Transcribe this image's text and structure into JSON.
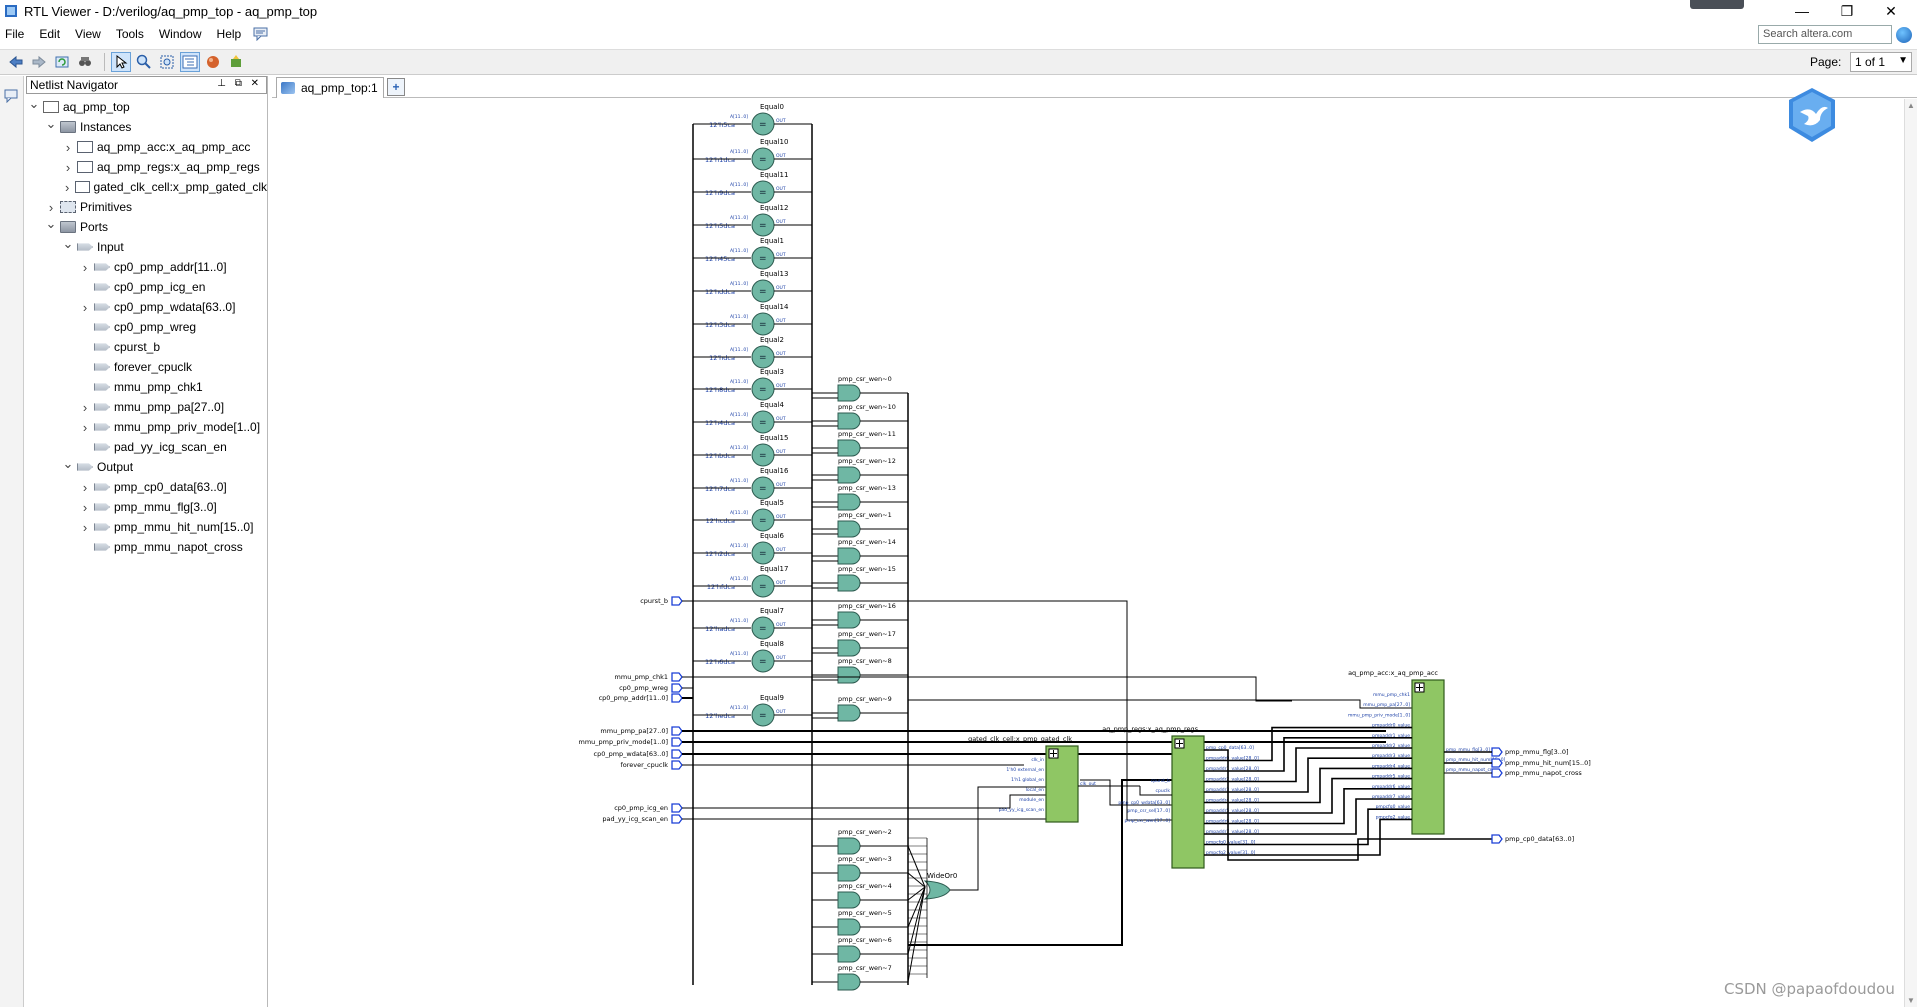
{
  "window": {
    "title": "RTL Viewer - D:/verilog/aq_pmp_top - aq_pmp_top",
    "minimize": "—",
    "maximize": "❐",
    "close": "✕"
  },
  "menu": [
    "File",
    "Edit",
    "View",
    "Tools",
    "Window",
    "Help"
  ],
  "search": {
    "placeholder": "Search altera.com"
  },
  "toolbar": {
    "page_label": "Page:",
    "page_value": "1 of 1"
  },
  "navigator": {
    "title": "Netlist Navigator",
    "tree": [
      {
        "label": "aq_pmp_top",
        "level": 0,
        "chev": "v",
        "icon": "top"
      },
      {
        "label": "Instances",
        "level": 1,
        "chev": "v",
        "icon": "folder"
      },
      {
        "label": "aq_pmp_acc:x_aq_pmp_acc",
        "level": 2,
        "chev": ">",
        "icon": "inst"
      },
      {
        "label": "aq_pmp_regs:x_aq_pmp_regs",
        "level": 2,
        "chev": ">",
        "icon": "inst"
      },
      {
        "label": "gated_clk_cell:x_pmp_gated_clk",
        "level": 2,
        "chev": ">",
        "icon": "inst"
      },
      {
        "label": "Primitives",
        "level": 1,
        "chev": ">",
        "icon": "prim"
      },
      {
        "label": "Ports",
        "level": 1,
        "chev": "v",
        "icon": "folder"
      },
      {
        "label": "Input",
        "level": 2,
        "chev": "v",
        "icon": "port"
      },
      {
        "label": "cp0_pmp_addr[11..0]",
        "level": 3,
        "chev": ">",
        "icon": "port"
      },
      {
        "label": "cp0_pmp_icg_en",
        "level": 3,
        "chev": "",
        "icon": "port"
      },
      {
        "label": "cp0_pmp_wdata[63..0]",
        "level": 3,
        "chev": ">",
        "icon": "port"
      },
      {
        "label": "cp0_pmp_wreg",
        "level": 3,
        "chev": "",
        "icon": "port"
      },
      {
        "label": "cpurst_b",
        "level": 3,
        "chev": "",
        "icon": "port"
      },
      {
        "label": "forever_cpuclk",
        "level": 3,
        "chev": "",
        "icon": "port"
      },
      {
        "label": "mmu_pmp_chk1",
        "level": 3,
        "chev": "",
        "icon": "port"
      },
      {
        "label": "mmu_pmp_pa[27..0]",
        "level": 3,
        "chev": ">",
        "icon": "port"
      },
      {
        "label": "mmu_pmp_priv_mode[1..0]",
        "level": 3,
        "chev": ">",
        "icon": "port"
      },
      {
        "label": "pad_yy_icg_scan_en",
        "level": 3,
        "chev": "",
        "icon": "port"
      },
      {
        "label": "Output",
        "level": 2,
        "chev": "v",
        "icon": "port"
      },
      {
        "label": "pmp_cp0_data[63..0]",
        "level": 3,
        "chev": ">",
        "icon": "port"
      },
      {
        "label": "pmp_mmu_flg[3..0]",
        "level": 3,
        "chev": ">",
        "icon": "port"
      },
      {
        "label": "pmp_mmu_hit_num[15..0]",
        "level": 3,
        "chev": ">",
        "icon": "port"
      },
      {
        "label": "pmp_mmu_napot_cross",
        "level": 3,
        "chev": "",
        "icon": "port"
      }
    ]
  },
  "editor": {
    "tab_label": "aq_pmp_top:1"
  },
  "schematic": {
    "comparators": [
      {
        "name": "Equal0",
        "const": "12'h5ca"
      },
      {
        "name": "Equal10",
        "const": "12'h1dca"
      },
      {
        "name": "Equal11",
        "const": "12'h9dca"
      },
      {
        "name": "Equal12",
        "const": "12'h5dca"
      },
      {
        "name": "Equal1",
        "const": "12'h45ca"
      },
      {
        "name": "Equal13",
        "const": "12'hddca"
      },
      {
        "name": "Equal14",
        "const": "12'h3dca"
      },
      {
        "name": "Equal2",
        "const": "12'hdca"
      },
      {
        "name": "Equal3",
        "const": "12'h8dca"
      },
      {
        "name": "Equal4",
        "const": "12'h4dca"
      },
      {
        "name": "Equal15",
        "const": "12'hbdca"
      },
      {
        "name": "Equal16",
        "const": "12'h7dca"
      },
      {
        "name": "Equal5",
        "const": "12'hcdca"
      },
      {
        "name": "Equal6",
        "const": "12'h2dca"
      },
      {
        "name": "Equal17",
        "const": "12'hfdca"
      },
      {
        "name": "Equal7",
        "const": "12'hadca"
      },
      {
        "name": "Equal8",
        "const": "12'h6dca"
      },
      {
        "name": "Equal9",
        "const": "12'hedca"
      }
    ],
    "wen_gates_top": [
      "pmp_csr_wen~0",
      "pmp_csr_wen~10",
      "pmp_csr_wen~11",
      "pmp_csr_wen~12",
      "pmp_csr_wen~13",
      "pmp_csr_wen~1",
      "pmp_csr_wen~14",
      "pmp_csr_wen~15",
      "pmp_csr_wen~16",
      "pmp_csr_wen~17",
      "pmp_csr_wen~8",
      "pmp_csr_wen~9"
    ],
    "wen_gates_bottom": [
      "pmp_csr_wen~2",
      "pmp_csr_wen~3",
      "pmp_csr_wen~4",
      "pmp_csr_wen~5",
      "pmp_csr_wen~6",
      "pmp_csr_wen~7"
    ],
    "input_ports": [
      "cpurst_b",
      "mmu_pmp_chk1",
      "cp0_pmp_wreg",
      "cp0_pmp_addr[11..0]",
      "mmu_pmp_pa[27..0]",
      "mmu_pmp_priv_mode[1..0]",
      "cp0_pmp_wdata[63..0]",
      "forever_cpuclk",
      "cp0_pmp_icg_en",
      "pad_yy_icg_scan_en"
    ],
    "output_ports": [
      "pmp_mmu_flg[3..0]",
      "pmp_mmu_hit_num[15..0]",
      "pmp_mmu_napot_cross",
      "pmp_cp0_data[63..0]"
    ],
    "modules": {
      "gated": {
        "title": "gated_clk_cell:x_pmp_gated_clk",
        "pins_in": [
          "clk_in",
          "1'h0 external_en",
          "1'h1 global_en",
          "local_en",
          "module_en",
          "pad_yy_icg_scan_en"
        ],
        "pins_out": [
          "clk_out"
        ]
      },
      "regs": {
        "title": "aq_pmp_regs:x_aq_pmp_regs",
        "pins_in": [
          "cpurst_b",
          "cpuclk",
          "pmp_cp0_wdata[63..0]",
          "pmp_csr_sel[17..0]",
          "pmp_csr_wen[17..0]"
        ],
        "pins_out": [
          "pmp_cp0_data[63..0]",
          "pmpaddr0_value[28..0]",
          "pmpaddr1_value[28..0]",
          "pmpaddr2_value[28..0]",
          "pmpaddr3_value[28..0]",
          "pmpaddr4_value[28..0]",
          "pmpaddr5_value[28..0]",
          "pmpaddr6_value[28..0]",
          "pmpaddr7_value[28..0]",
          "pmpcfg0_value[31..0]",
          "pmpcfg2_value[31..0]"
        ]
      },
      "acc": {
        "title": "aq_pmp_acc:x_aq_pmp_acc",
        "pins_in": [
          "mmu_pmp_chk1",
          "mmu_pmp_pa[27..0]",
          "mmu_pmp_priv_mode[1..0]",
          "pmpaddr0_value",
          "pmpaddr1_value",
          "pmpaddr2_value",
          "pmpaddr3_value",
          "pmpaddr4_value",
          "pmpaddr5_value",
          "pmpaddr6_value",
          "pmpaddr7_value",
          "pmpcfg0_value",
          "pmpcfg2_value"
        ],
        "pins_out": [
          "pmp_mmu_flg[3..0]",
          "pmp_mmu_hit_num[15..0]",
          "pmp_mmu_napot_cross"
        ]
      }
    },
    "or_gate": "WideOr0"
  },
  "watermark": "CSDN @papaofdoudou",
  "colors": {
    "gate_fill": "#6fb7a4",
    "module_fill": "#8fc664",
    "port_stroke": "#1a3fd6",
    "wire": "#000000"
  }
}
